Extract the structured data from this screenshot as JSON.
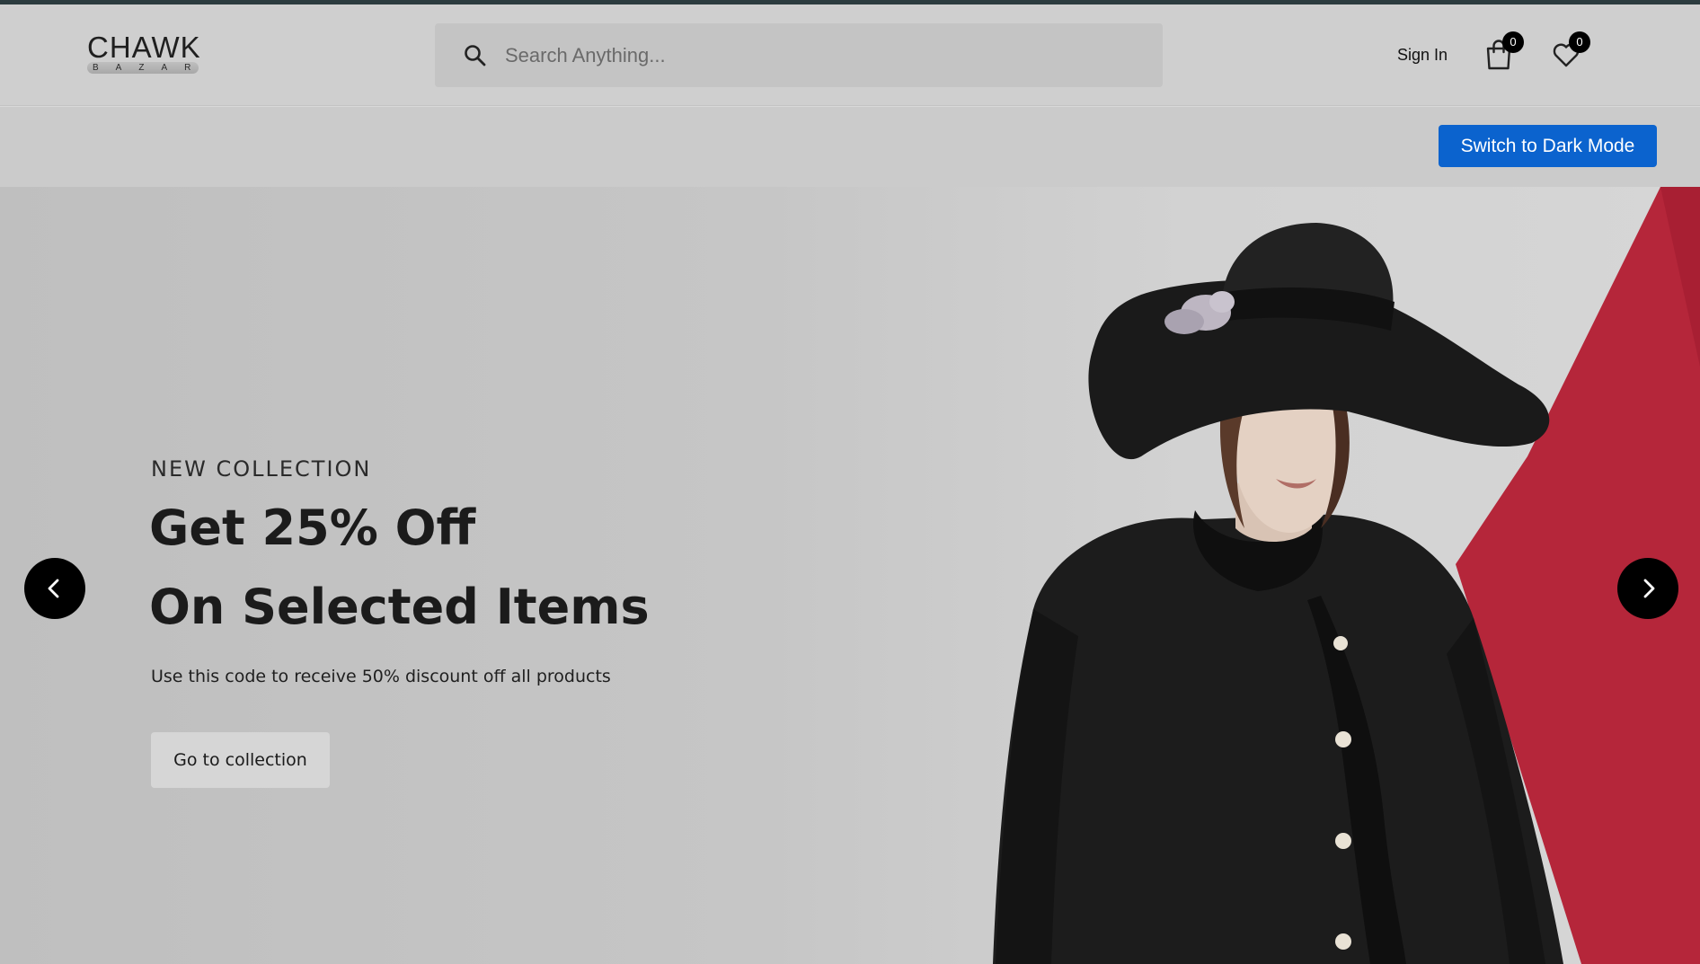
{
  "header": {
    "logo": {
      "main": "CHAWK",
      "sub": "BAZAR"
    },
    "search": {
      "placeholder": "Search Anything...",
      "icon": "search-icon"
    },
    "sign_in_label": "Sign In",
    "cart": {
      "icon": "shopping-bag-icon",
      "count": "0"
    },
    "wishlist": {
      "icon": "heart-icon",
      "count": "0"
    }
  },
  "dark_mode_button": "Switch to Dark Mode",
  "hero": {
    "eyebrow": "NEW COLLECTION",
    "title_line1": "Get 25% Off",
    "title_line2": "On Selected Items",
    "subtitle": "Use this code to receive 50% discount off all products",
    "cta_label": "Go to collection",
    "prev_icon": "chevron-left-icon",
    "next_icon": "chevron-right-icon"
  },
  "colors": {
    "accent": "#0b63ce",
    "hero_red": "#c0233a",
    "top_line": "#2c3c3f"
  }
}
